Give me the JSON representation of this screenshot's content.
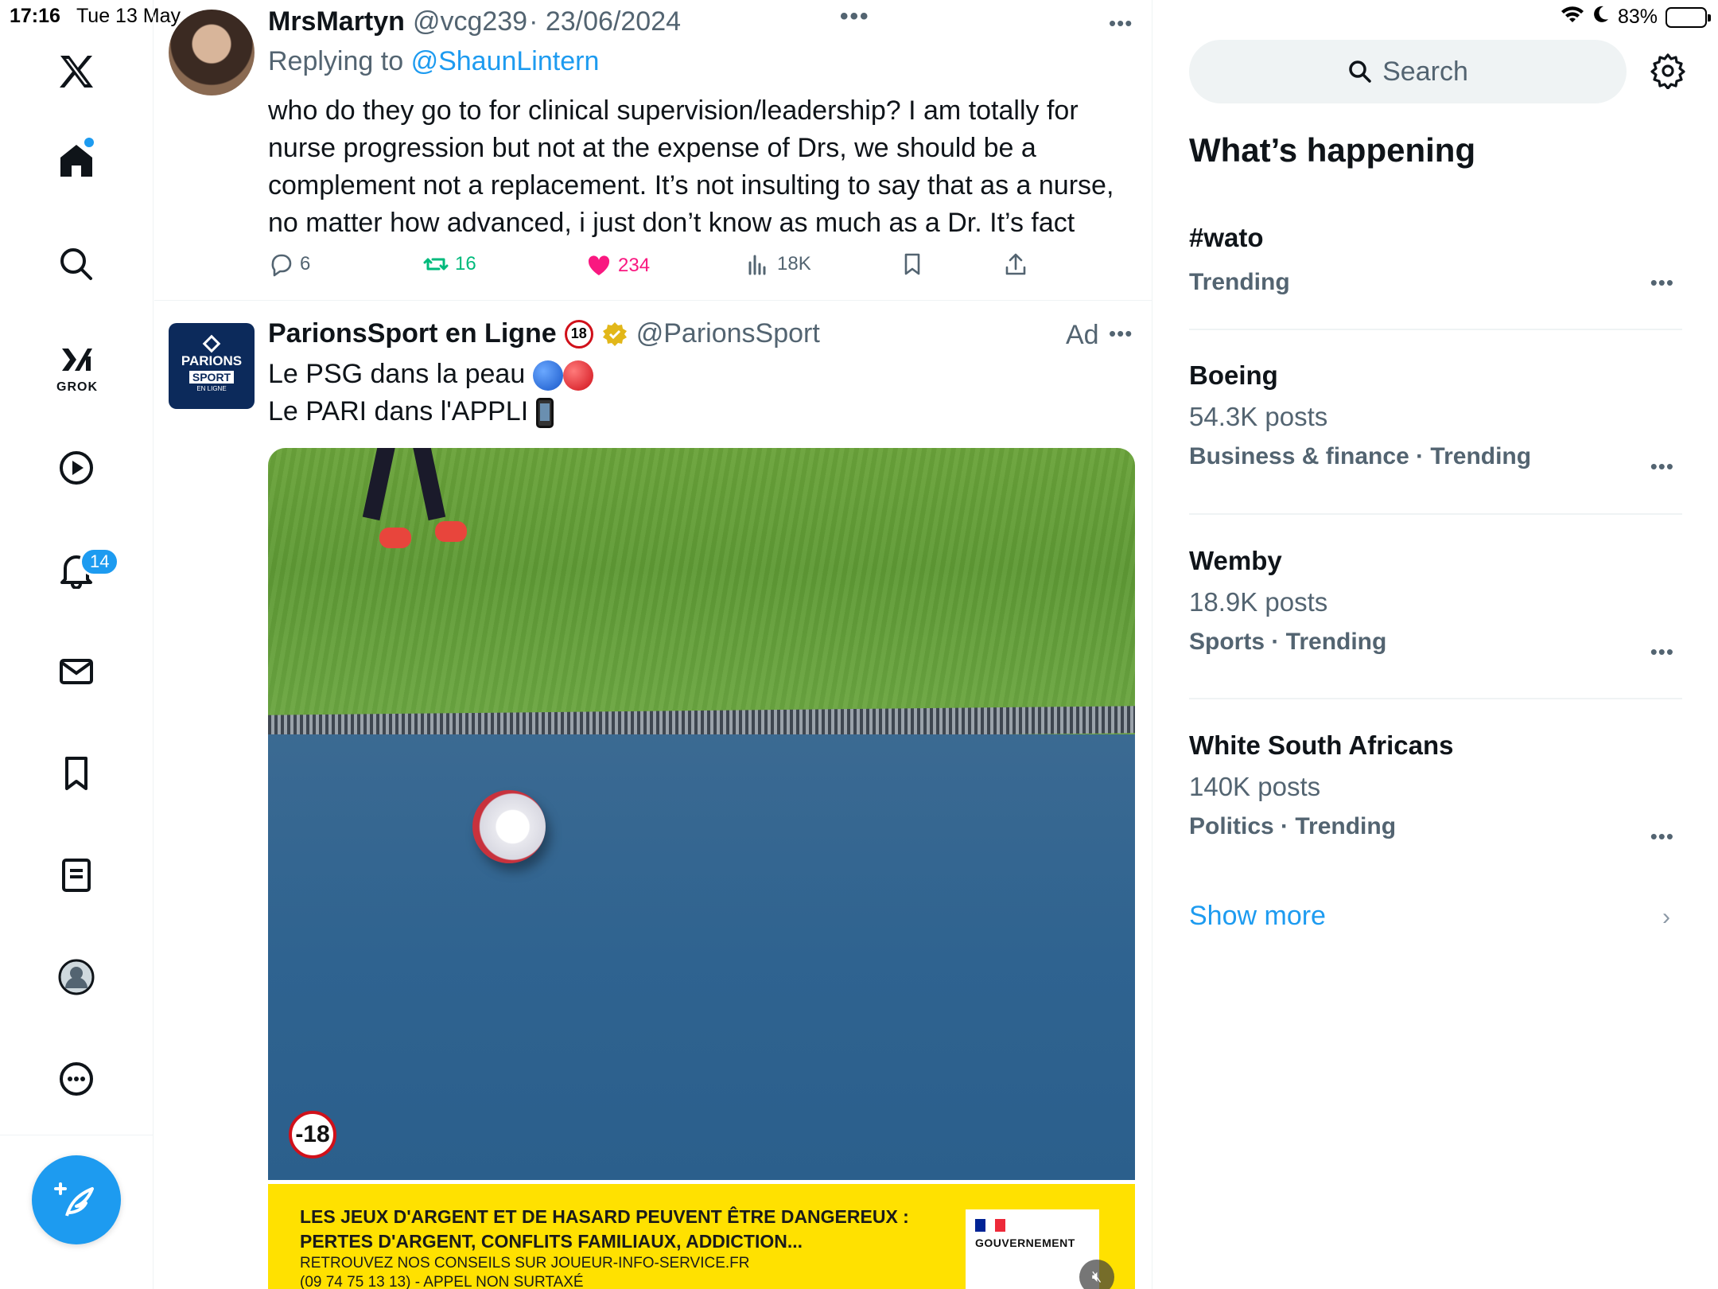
{
  "status_bar": {
    "time": "17:16",
    "date": "Tue 13 May",
    "battery": "83%",
    "battery_level": 0.83
  },
  "nav": {
    "grok_label": "GROK",
    "notifications_count": "14"
  },
  "tweet1": {
    "name": "MrsMartyn",
    "handle": "@vcg239",
    "date": "· 23/06/2024",
    "replying_prefix": "Replying to",
    "replying_to": "@ShaunLintern",
    "text": "who do they go to for clinical supervision/leadership? I am totally for nurse progression but not at the expense of Drs, we should be a complement not a replacement. It’s not insulting to say that as a nurse, no matter how advanced, i just don’t know as much as a Dr. It’s fact",
    "replies": "6",
    "reposts": "16",
    "likes": "234",
    "views": "18K"
  },
  "tweet2": {
    "name": "ParionsSport en Ligne",
    "handle": "@ParionsSport",
    "ad_label": "Ad",
    "line1": "Le PSG dans la peau",
    "line2": "Le PARI dans l'APPLI",
    "avatar_logo_1": "PARIONS",
    "avatar_logo_2": "SPORT",
    "avatar_logo_3": "EN LIGNE",
    "media": {
      "age_badge": "-18",
      "warning_line1": "LES JEUX D'ARGENT ET DE HASARD PEUVENT ÊTRE DANGEREUX :",
      "warning_line2": "PERTES D'ARGENT, CONFLITS FAMILIAUX, ADDICTION...",
      "warning_line3": "RETROUVEZ NOS CONSEILS SUR JOUEUR-INFO-SERVICE.FR",
      "warning_line4": "(09 74 75  13 13) - APPEL NON SURTAXÉ",
      "gov_label": "GOUVERNEMENT"
    }
  },
  "right": {
    "search_placeholder": "Search",
    "title": "What’s happening",
    "trends": [
      {
        "name": "#wato",
        "posts": "",
        "category": "Trending"
      },
      {
        "name": "Boeing",
        "posts": "54.3K posts",
        "category": "Business & finance · Trending"
      },
      {
        "name": "Wemby",
        "posts": "18.9K posts",
        "category": "Sports · Trending"
      },
      {
        "name": "White South Africans",
        "posts": "140K posts",
        "category": "Politics · Trending"
      }
    ],
    "show_more": "Show more"
  },
  "colors": {
    "accent": "#1d9bf0",
    "repost": "#00ba7c",
    "like": "#f91880",
    "secondary_text": "#536471"
  },
  "icons": [
    "x-logo-icon",
    "home-icon",
    "search-icon",
    "grok-icon",
    "video-icon",
    "bell-icon",
    "mail-icon",
    "bookmark-icon",
    "lists-icon",
    "profile-icon",
    "more-icon",
    "compose-icon",
    "gear-icon",
    "reply-icon",
    "repost-icon",
    "like-icon",
    "views-icon",
    "share-icon"
  ]
}
